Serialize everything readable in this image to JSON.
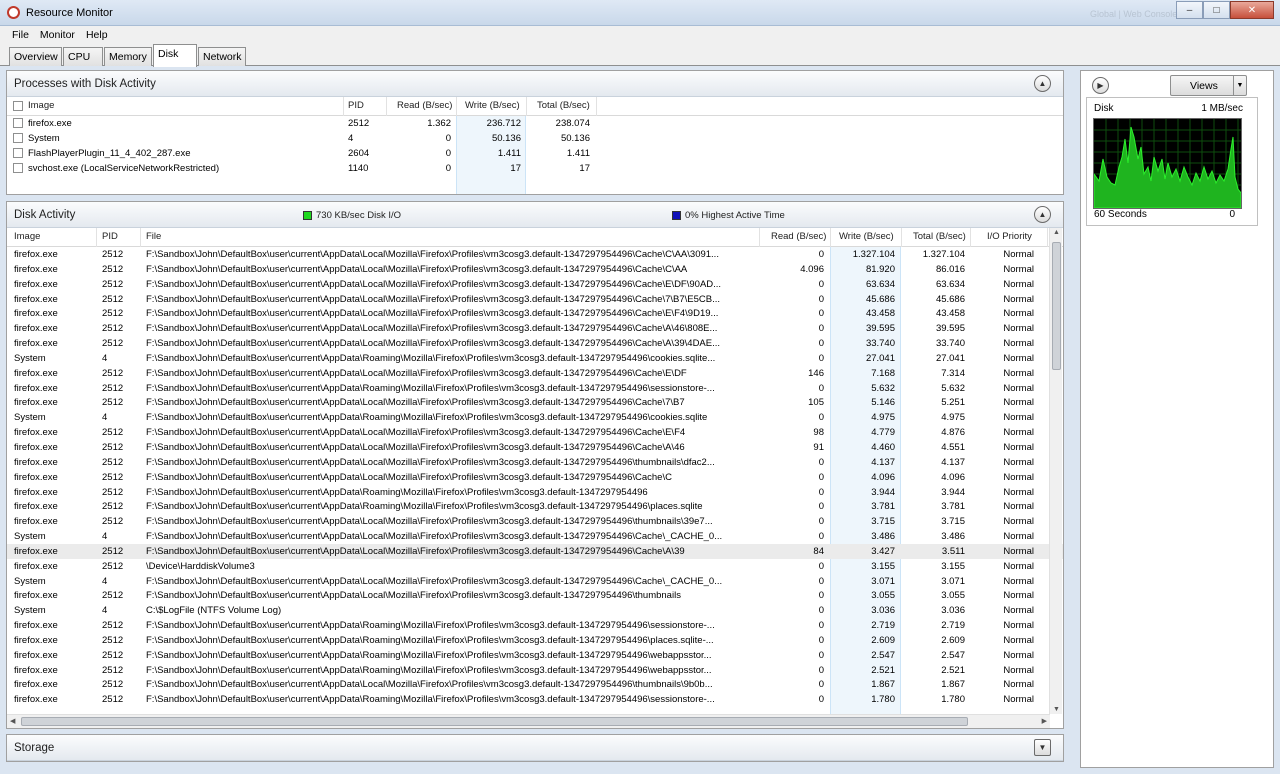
{
  "window": {
    "title": "Resource Monitor",
    "faded_text": "Global | Web Console Monitor"
  },
  "menu": [
    "File",
    "Monitor",
    "Help"
  ],
  "tabs": [
    {
      "label": "Overview",
      "active": false
    },
    {
      "label": "CPU",
      "active": false
    },
    {
      "label": "Memory",
      "active": false
    },
    {
      "label": "Disk",
      "active": true
    },
    {
      "label": "Network",
      "active": false
    }
  ],
  "processes": {
    "title": "Processes with Disk Activity",
    "columns": [
      "Image",
      "PID",
      "Read (B/sec)",
      "Write (B/sec)",
      "Total (B/sec)"
    ],
    "rows": [
      {
        "image": "firefox.exe",
        "pid": "2512",
        "read": "1.362",
        "write": "236.712",
        "total": "238.074"
      },
      {
        "image": "System",
        "pid": "4",
        "read": "0",
        "write": "50.136",
        "total": "50.136"
      },
      {
        "image": "FlashPlayerPlugin_11_4_402_287.exe",
        "pid": "2604",
        "read": "0",
        "write": "1.411",
        "total": "1.411"
      },
      {
        "image": "svchost.exe (LocalServiceNetworkRestricted)",
        "pid": "1140",
        "read": "0",
        "write": "17",
        "total": "17"
      }
    ]
  },
  "disk_activity": {
    "title": "Disk Activity",
    "io_label": "730 KB/sec Disk I/O",
    "active_label": "0% Highest Active Time",
    "io_color": "#1fd81f",
    "active_color": "#1010b8",
    "columns": [
      "Image",
      "PID",
      "File",
      "Read (B/sec)",
      "Write (B/sec)",
      "Total (B/sec)",
      "I/O Priority"
    ],
    "rows": [
      {
        "image": "firefox.exe",
        "pid": "2512",
        "file": "F:\\Sandbox\\John\\DefaultBox\\user\\current\\AppData\\Local\\Mozilla\\Firefox\\Profiles\\vm3cosg3.default-1347297954496\\Cache\\C\\AA\\3091...",
        "read": "0",
        "write": "1.327.104",
        "total": "1.327.104",
        "prio": "Normal"
      },
      {
        "image": "firefox.exe",
        "pid": "2512",
        "file": "F:\\Sandbox\\John\\DefaultBox\\user\\current\\AppData\\Local\\Mozilla\\Firefox\\Profiles\\vm3cosg3.default-1347297954496\\Cache\\C\\AA",
        "read": "4.096",
        "write": "81.920",
        "total": "86.016",
        "prio": "Normal"
      },
      {
        "image": "firefox.exe",
        "pid": "2512",
        "file": "F:\\Sandbox\\John\\DefaultBox\\user\\current\\AppData\\Local\\Mozilla\\Firefox\\Profiles\\vm3cosg3.default-1347297954496\\Cache\\E\\DF\\90AD...",
        "read": "0",
        "write": "63.634",
        "total": "63.634",
        "prio": "Normal"
      },
      {
        "image": "firefox.exe",
        "pid": "2512",
        "file": "F:\\Sandbox\\John\\DefaultBox\\user\\current\\AppData\\Local\\Mozilla\\Firefox\\Profiles\\vm3cosg3.default-1347297954496\\Cache\\7\\B7\\E5CB...",
        "read": "0",
        "write": "45.686",
        "total": "45.686",
        "prio": "Normal"
      },
      {
        "image": "firefox.exe",
        "pid": "2512",
        "file": "F:\\Sandbox\\John\\DefaultBox\\user\\current\\AppData\\Local\\Mozilla\\Firefox\\Profiles\\vm3cosg3.default-1347297954496\\Cache\\E\\F4\\9D19...",
        "read": "0",
        "write": "43.458",
        "total": "43.458",
        "prio": "Normal"
      },
      {
        "image": "firefox.exe",
        "pid": "2512",
        "file": "F:\\Sandbox\\John\\DefaultBox\\user\\current\\AppData\\Local\\Mozilla\\Firefox\\Profiles\\vm3cosg3.default-1347297954496\\Cache\\A\\46\\808E...",
        "read": "0",
        "write": "39.595",
        "total": "39.595",
        "prio": "Normal"
      },
      {
        "image": "firefox.exe",
        "pid": "2512",
        "file": "F:\\Sandbox\\John\\DefaultBox\\user\\current\\AppData\\Local\\Mozilla\\Firefox\\Profiles\\vm3cosg3.default-1347297954496\\Cache\\A\\39\\4DAE...",
        "read": "0",
        "write": "33.740",
        "total": "33.740",
        "prio": "Normal"
      },
      {
        "image": "System",
        "pid": "4",
        "file": "F:\\Sandbox\\John\\DefaultBox\\user\\current\\AppData\\Roaming\\Mozilla\\Firefox\\Profiles\\vm3cosg3.default-1347297954496\\cookies.sqlite...",
        "read": "0",
        "write": "27.041",
        "total": "27.041",
        "prio": "Normal"
      },
      {
        "image": "firefox.exe",
        "pid": "2512",
        "file": "F:\\Sandbox\\John\\DefaultBox\\user\\current\\AppData\\Local\\Mozilla\\Firefox\\Profiles\\vm3cosg3.default-1347297954496\\Cache\\E\\DF",
        "read": "146",
        "write": "7.168",
        "total": "7.314",
        "prio": "Normal"
      },
      {
        "image": "firefox.exe",
        "pid": "2512",
        "file": "F:\\Sandbox\\John\\DefaultBox\\user\\current\\AppData\\Roaming\\Mozilla\\Firefox\\Profiles\\vm3cosg3.default-1347297954496\\sessionstore-...",
        "read": "0",
        "write": "5.632",
        "total": "5.632",
        "prio": "Normal"
      },
      {
        "image": "firefox.exe",
        "pid": "2512",
        "file": "F:\\Sandbox\\John\\DefaultBox\\user\\current\\AppData\\Local\\Mozilla\\Firefox\\Profiles\\vm3cosg3.default-1347297954496\\Cache\\7\\B7",
        "read": "105",
        "write": "5.146",
        "total": "5.251",
        "prio": "Normal"
      },
      {
        "image": "System",
        "pid": "4",
        "file": "F:\\Sandbox\\John\\DefaultBox\\user\\current\\AppData\\Roaming\\Mozilla\\Firefox\\Profiles\\vm3cosg3.default-1347297954496\\cookies.sqlite",
        "read": "0",
        "write": "4.975",
        "total": "4.975",
        "prio": "Normal"
      },
      {
        "image": "firefox.exe",
        "pid": "2512",
        "file": "F:\\Sandbox\\John\\DefaultBox\\user\\current\\AppData\\Local\\Mozilla\\Firefox\\Profiles\\vm3cosg3.default-1347297954496\\Cache\\E\\F4",
        "read": "98",
        "write": "4.779",
        "total": "4.876",
        "prio": "Normal"
      },
      {
        "image": "firefox.exe",
        "pid": "2512",
        "file": "F:\\Sandbox\\John\\DefaultBox\\user\\current\\AppData\\Local\\Mozilla\\Firefox\\Profiles\\vm3cosg3.default-1347297954496\\Cache\\A\\46",
        "read": "91",
        "write": "4.460",
        "total": "4.551",
        "prio": "Normal"
      },
      {
        "image": "firefox.exe",
        "pid": "2512",
        "file": "F:\\Sandbox\\John\\DefaultBox\\user\\current\\AppData\\Local\\Mozilla\\Firefox\\Profiles\\vm3cosg3.default-1347297954496\\thumbnails\\dfac2...",
        "read": "0",
        "write": "4.137",
        "total": "4.137",
        "prio": "Normal"
      },
      {
        "image": "firefox.exe",
        "pid": "2512",
        "file": "F:\\Sandbox\\John\\DefaultBox\\user\\current\\AppData\\Local\\Mozilla\\Firefox\\Profiles\\vm3cosg3.default-1347297954496\\Cache\\C",
        "read": "0",
        "write": "4.096",
        "total": "4.096",
        "prio": "Normal"
      },
      {
        "image": "firefox.exe",
        "pid": "2512",
        "file": "F:\\Sandbox\\John\\DefaultBox\\user\\current\\AppData\\Roaming\\Mozilla\\Firefox\\Profiles\\vm3cosg3.default-1347297954496",
        "read": "0",
        "write": "3.944",
        "total": "3.944",
        "prio": "Normal"
      },
      {
        "image": "firefox.exe",
        "pid": "2512",
        "file": "F:\\Sandbox\\John\\DefaultBox\\user\\current\\AppData\\Roaming\\Mozilla\\Firefox\\Profiles\\vm3cosg3.default-1347297954496\\places.sqlite",
        "read": "0",
        "write": "3.781",
        "total": "3.781",
        "prio": "Normal"
      },
      {
        "image": "firefox.exe",
        "pid": "2512",
        "file": "F:\\Sandbox\\John\\DefaultBox\\user\\current\\AppData\\Local\\Mozilla\\Firefox\\Profiles\\vm3cosg3.default-1347297954496\\thumbnails\\39e7...",
        "read": "0",
        "write": "3.715",
        "total": "3.715",
        "prio": "Normal"
      },
      {
        "image": "System",
        "pid": "4",
        "file": "F:\\Sandbox\\John\\DefaultBox\\user\\current\\AppData\\Local\\Mozilla\\Firefox\\Profiles\\vm3cosg3.default-1347297954496\\Cache\\_CACHE_0...",
        "read": "0",
        "write": "3.486",
        "total": "3.486",
        "prio": "Normal"
      },
      {
        "image": "firefox.exe",
        "pid": "2512",
        "file": "F:\\Sandbox\\John\\DefaultBox\\user\\current\\AppData\\Local\\Mozilla\\Firefox\\Profiles\\vm3cosg3.default-1347297954496\\Cache\\A\\39",
        "read": "84",
        "write": "3.427",
        "total": "3.511",
        "prio": "Normal",
        "selected": true
      },
      {
        "image": "firefox.exe",
        "pid": "2512",
        "file": "\\Device\\HarddiskVolume3",
        "read": "0",
        "write": "3.155",
        "total": "3.155",
        "prio": "Normal"
      },
      {
        "image": "System",
        "pid": "4",
        "file": "F:\\Sandbox\\John\\DefaultBox\\user\\current\\AppData\\Local\\Mozilla\\Firefox\\Profiles\\vm3cosg3.default-1347297954496\\Cache\\_CACHE_0...",
        "read": "0",
        "write": "3.071",
        "total": "3.071",
        "prio": "Normal"
      },
      {
        "image": "firefox.exe",
        "pid": "2512",
        "file": "F:\\Sandbox\\John\\DefaultBox\\user\\current\\AppData\\Local\\Mozilla\\Firefox\\Profiles\\vm3cosg3.default-1347297954496\\thumbnails",
        "read": "0",
        "write": "3.055",
        "total": "3.055",
        "prio": "Normal"
      },
      {
        "image": "System",
        "pid": "4",
        "file": "C:\\$LogFile (NTFS Volume Log)",
        "read": "0",
        "write": "3.036",
        "total": "3.036",
        "prio": "Normal"
      },
      {
        "image": "firefox.exe",
        "pid": "2512",
        "file": "F:\\Sandbox\\John\\DefaultBox\\user\\current\\AppData\\Roaming\\Mozilla\\Firefox\\Profiles\\vm3cosg3.default-1347297954496\\sessionstore-...",
        "read": "0",
        "write": "2.719",
        "total": "2.719",
        "prio": "Normal"
      },
      {
        "image": "firefox.exe",
        "pid": "2512",
        "file": "F:\\Sandbox\\John\\DefaultBox\\user\\current\\AppData\\Roaming\\Mozilla\\Firefox\\Profiles\\vm3cosg3.default-1347297954496\\places.sqlite-...",
        "read": "0",
        "write": "2.609",
        "total": "2.609",
        "prio": "Normal"
      },
      {
        "image": "firefox.exe",
        "pid": "2512",
        "file": "F:\\Sandbox\\John\\DefaultBox\\user\\current\\AppData\\Roaming\\Mozilla\\Firefox\\Profiles\\vm3cosg3.default-1347297954496\\webappsstor...",
        "read": "0",
        "write": "2.547",
        "total": "2.547",
        "prio": "Normal"
      },
      {
        "image": "firefox.exe",
        "pid": "2512",
        "file": "F:\\Sandbox\\John\\DefaultBox\\user\\current\\AppData\\Roaming\\Mozilla\\Firefox\\Profiles\\vm3cosg3.default-1347297954496\\webappsstor...",
        "read": "0",
        "write": "2.521",
        "total": "2.521",
        "prio": "Normal"
      },
      {
        "image": "firefox.exe",
        "pid": "2512",
        "file": "F:\\Sandbox\\John\\DefaultBox\\user\\current\\AppData\\Local\\Mozilla\\Firefox\\Profiles\\vm3cosg3.default-1347297954496\\thumbnails\\9b0b...",
        "read": "0",
        "write": "1.867",
        "total": "1.867",
        "prio": "Normal"
      },
      {
        "image": "firefox.exe",
        "pid": "2512",
        "file": "F:\\Sandbox\\John\\DefaultBox\\user\\current\\AppData\\Roaming\\Mozilla\\Firefox\\Profiles\\vm3cosg3.default-1347297954496\\sessionstore-...",
        "read": "0",
        "write": "1.780",
        "total": "1.780",
        "prio": "Normal"
      }
    ]
  },
  "storage": {
    "title": "Storage"
  },
  "side": {
    "views_label": "Views",
    "disk_label": "Disk",
    "scale_label": "1 MB/sec",
    "time_label": "60 Seconds",
    "zero_label": "0",
    "graph_color": "#1fd81f"
  }
}
